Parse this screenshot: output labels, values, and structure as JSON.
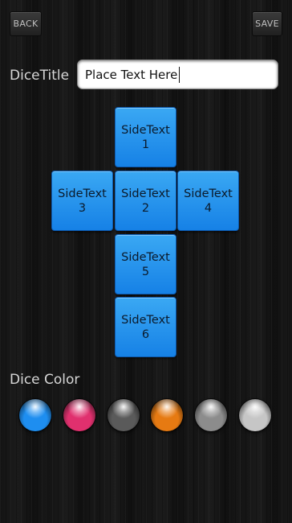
{
  "toolbar": {
    "back_label": "BACK",
    "save_label": "SAVE"
  },
  "dice_title": {
    "label": "DiceTitle",
    "value": "Place Text Here"
  },
  "faces": [
    {
      "line1": "SideText",
      "line2": "1"
    },
    {
      "line1": "SideText",
      "line2": "2"
    },
    {
      "line1": "SideText",
      "line2": "3"
    },
    {
      "line1": "SideText",
      "line2": "4"
    },
    {
      "line1": "SideText",
      "line2": "5"
    },
    {
      "line1": "SideText",
      "line2": "6"
    }
  ],
  "dice_color": {
    "label": "Dice Color",
    "options": [
      {
        "name": "blue",
        "color": "#1e8ef0"
      },
      {
        "name": "pink",
        "color": "#e0306e"
      },
      {
        "name": "dark-gray",
        "color": "#5a5a5a"
      },
      {
        "name": "orange",
        "color": "#e67a12"
      },
      {
        "name": "gray",
        "color": "#8c8c8c"
      },
      {
        "name": "light-gray",
        "color": "#c6c6c6"
      }
    ]
  }
}
